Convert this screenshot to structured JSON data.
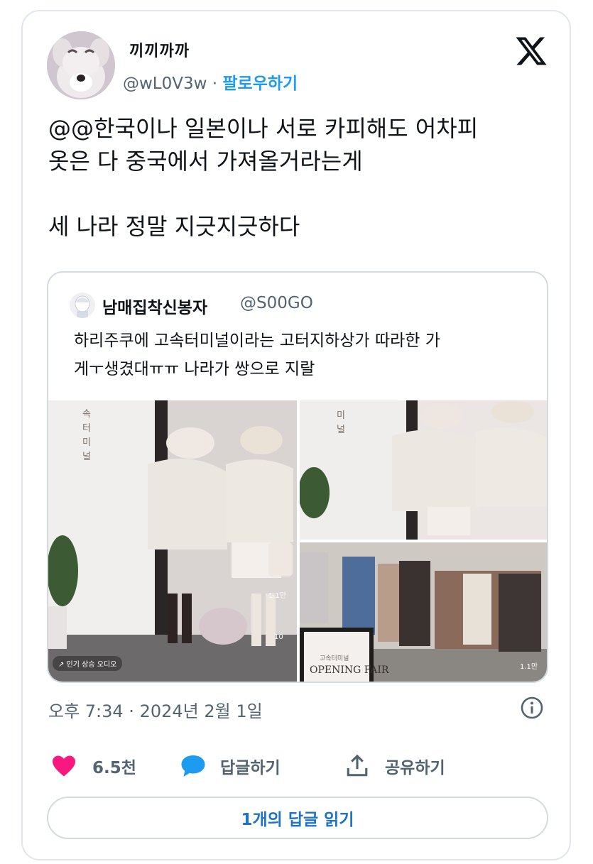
{
  "user": {
    "display_name": "끼끼까까",
    "handle": "@wL0V3w",
    "separator": "·",
    "follow_label": "팔로우하기"
  },
  "tweet": {
    "text": "@@한국이나 일본이나 서로 카피해도 어차피\n옷은 다 중국에서 가져올거라는게\n\n세 나라 정말 지긋지긋하다"
  },
  "quoted": {
    "display_name": "남매집착신봉자",
    "handle": "@S00GO",
    "text": "하리주쿠에 고속터미널이라는 고터지하상가 따라한 가\n게ㅜ생겼대ㅠㅠ 나라가 쌍으로 지랄",
    "media": {
      "sign_vertical": "속터미널",
      "sign_vertical_2": "미널",
      "audio_label": "↗ 인기 상승 오디오",
      "like_count": "1.1만",
      "comment_count": "10",
      "like_count_2": "1.1만",
      "banner_small": "고속터미널",
      "banner_large": "OPENING FAIR"
    }
  },
  "timestamp": "오후 7:34 · 2024년 2월 1일",
  "actions": {
    "like_count": "6.5천",
    "reply_label": "답글하기",
    "share_label": "공유하기"
  },
  "read_replies_label": "1개의 답글 읽기",
  "colors": {
    "accent": "#1d9bf0",
    "like": "#f91880",
    "secondary_text": "#536471"
  }
}
